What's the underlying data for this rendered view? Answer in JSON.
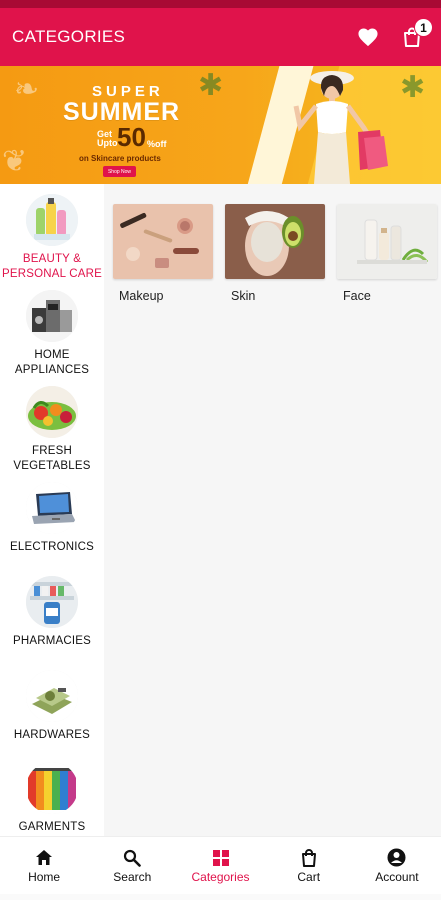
{
  "app_bar": {
    "title": "CATEGORIES",
    "wishlist_icon": "heart-icon",
    "cart_icon": "shopping-bag-icon",
    "cart_count": "1",
    "bg_color": "#e0134b"
  },
  "banner": {
    "super": "SUPER",
    "summer": "SUMMER",
    "get": "Get",
    "upto": "Upto",
    "percent": "50",
    "off": "%off",
    "skincare": "on Skincare products",
    "button": "Shop Now"
  },
  "categories": [
    {
      "label": "BEAUTY & PERSONAL CARE",
      "icon": "beauty-products-icon",
      "active": true
    },
    {
      "label": "HOME APPLIANCES",
      "icon": "home-appliances-icon",
      "active": false
    },
    {
      "label": "FRESH VEGETABLES",
      "icon": "vegetables-icon",
      "active": false
    },
    {
      "label": "ELECTRONICS",
      "icon": "laptop-icon",
      "active": false
    },
    {
      "label": "PHARMACIES",
      "icon": "pharmacy-icon",
      "active": false
    },
    {
      "label": "HARDWARES",
      "icon": "hardware-icon",
      "active": false
    },
    {
      "label": "GARMENTS",
      "icon": "garments-icon",
      "active": false
    }
  ],
  "subcategories": [
    {
      "label": "Makeup",
      "icon": "makeup-image"
    },
    {
      "label": "Skin",
      "icon": "skin-image"
    },
    {
      "label": "Face",
      "icon": "face-image"
    }
  ],
  "bottom_nav": [
    {
      "label": "Home",
      "icon": "home-icon",
      "active": false
    },
    {
      "label": "Search",
      "icon": "search-icon",
      "active": false
    },
    {
      "label": "Categories",
      "icon": "categories-icon",
      "active": true
    },
    {
      "label": "Cart",
      "icon": "cart-icon",
      "active": false
    },
    {
      "label": "Account",
      "icon": "account-icon",
      "active": false
    }
  ],
  "colors": {
    "accent": "#e0134b",
    "banner": "#f7a61a"
  }
}
